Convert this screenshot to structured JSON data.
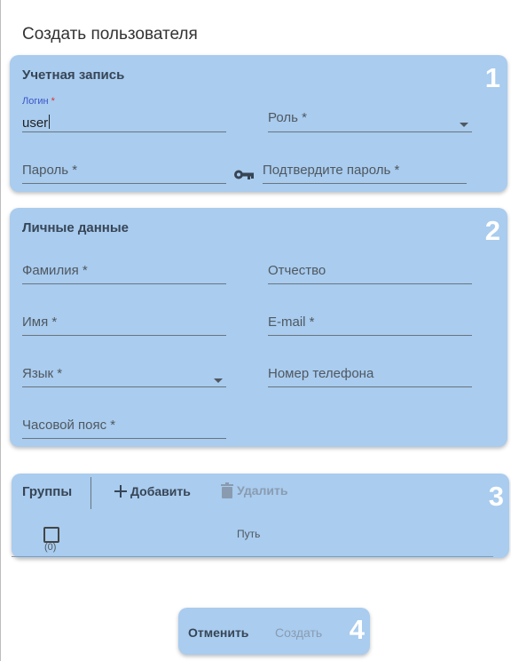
{
  "dialog": {
    "title": "Создать пользователя"
  },
  "account": {
    "title": "Учетная запись",
    "number": "1",
    "login": {
      "label": "Логин",
      "required_mark": "*",
      "value": "user"
    },
    "role": {
      "label": "Роль *"
    },
    "password": {
      "label": "Пароль *"
    },
    "confirm_password": {
      "label": "Подтвердите пароль *"
    }
  },
  "personal": {
    "title": "Личные данные",
    "number": "2",
    "last_name": {
      "label": "Фамилия *"
    },
    "middle_name": {
      "label": "Отчество"
    },
    "first_name": {
      "label": "Имя *"
    },
    "email": {
      "label": "E-mail *"
    },
    "language": {
      "label": "Язык *"
    },
    "phone": {
      "label": "Номер телефона"
    },
    "timezone": {
      "label": "Часовой пояс *"
    }
  },
  "groups": {
    "title": "Группы",
    "number": "3",
    "add_label": "Добавить",
    "delete_label": "Удалить",
    "count": "(0)",
    "path_header": "Путь"
  },
  "footer": {
    "number": "4",
    "cancel_label": "Отменить",
    "create_label": "Создать"
  },
  "colors": {
    "card_bg": "#a9ccef",
    "accent": "#3a55c8",
    "required": "#e03030"
  }
}
